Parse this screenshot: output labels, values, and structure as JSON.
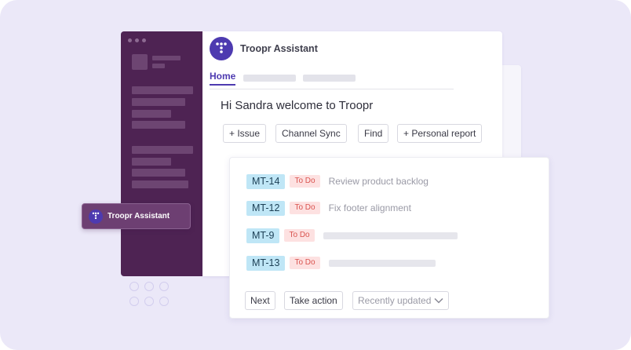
{
  "app": {
    "title": "Troopr Assistant",
    "greeting": "Hi Sandra welcome to Troopr",
    "accent_color": "#4d3ab0",
    "sidebar_color": "#4e2353"
  },
  "tabs": [
    {
      "label": "Home",
      "active": true
    }
  ],
  "actions": [
    {
      "label": "+ Issue"
    },
    {
      "label": "Channel Sync"
    },
    {
      "label": "Find"
    },
    {
      "label": "+ Personal report"
    }
  ],
  "sidebar": {
    "highlighted_item": {
      "label": "Troopr Assistant",
      "icon": "troopr-logo-icon"
    }
  },
  "issues": [
    {
      "key": "MT-14",
      "status": "To Do",
      "summary": "Review product backlog"
    },
    {
      "key": "MT-12",
      "status": "To Do",
      "summary": "Fix footer alignment"
    },
    {
      "key": "MT-9",
      "status": "To Do",
      "summary": ""
    },
    {
      "key": "MT-13",
      "status": "To Do",
      "summary": ""
    }
  ],
  "footer": {
    "next_label": "Next",
    "take_action_label": "Take action",
    "sort_selected": "Recently updated",
    "sort_icon": "chevron-down-icon"
  }
}
